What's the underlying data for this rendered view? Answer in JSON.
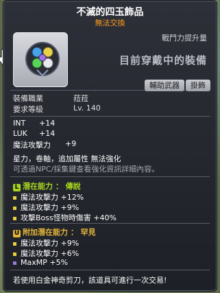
{
  "item": {
    "name": "不滅的四玉飾品",
    "trade": "無法交換"
  },
  "header": {
    "power_label": "戰鬥力提升量",
    "equipped_text": "目前穿戴中的裝備"
  },
  "requirements": {
    "job_label": "裝備職業",
    "job_value": "菈菈",
    "level_label": "要求等級",
    "level_value": "Lv. 140"
  },
  "tags": [
    "輔助武器",
    "掛飾"
  ],
  "stats": [
    {
      "name": "INT",
      "value": "+14"
    },
    {
      "name": "LUK",
      "value": "+14"
    },
    {
      "name": "魔法攻擊力",
      "value": "+9"
    }
  ],
  "misc": {
    "line1": "星力，卷軸，追加屬性 無法強化",
    "line2": "可透過NPC/採集鍵查看強化資訊詳細內容。"
  },
  "potential": {
    "badge": "L",
    "label": "潛在能力 ： 傳說",
    "color": "#a6d41e",
    "lines": [
      "魔法攻擊力 +12%",
      "魔法攻擊力 +9%",
      "攻擊Boss怪物時傷害 +40%"
    ],
    "dot_colors": [
      "#e9d23a",
      "#e9d23a",
      "#e9d23a"
    ]
  },
  "additional": {
    "badge": "U",
    "label": "附加潛在能力 ： 罕見",
    "color": "#e3b43a",
    "lines": [
      "魔法攻擊力 +9%",
      "魔法攻擊力 +6%",
      "MaxMP +5%"
    ],
    "dot_colors": [
      "#e9d23a",
      "#e9d23a",
      "#9a7bd8"
    ]
  },
  "footer": "若使用白金神奇剪刀，該道具可進行一次交易!"
}
